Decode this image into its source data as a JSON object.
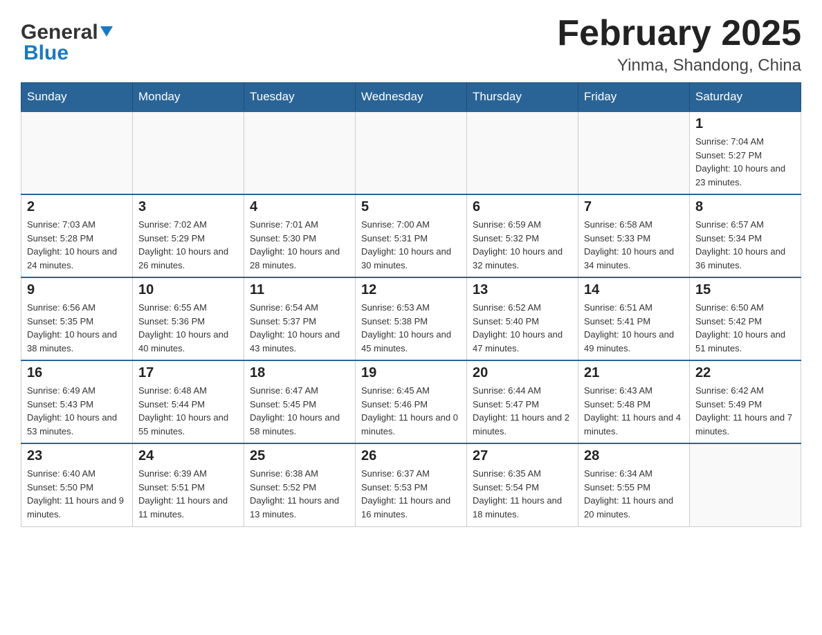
{
  "header": {
    "logo_general": "General",
    "logo_blue": "Blue",
    "month_title": "February 2025",
    "location": "Yinma, Shandong, China"
  },
  "weekdays": [
    "Sunday",
    "Monday",
    "Tuesday",
    "Wednesday",
    "Thursday",
    "Friday",
    "Saturday"
  ],
  "weeks": [
    [
      {
        "day": "",
        "sunrise": "",
        "sunset": "",
        "daylight": ""
      },
      {
        "day": "",
        "sunrise": "",
        "sunset": "",
        "daylight": ""
      },
      {
        "day": "",
        "sunrise": "",
        "sunset": "",
        "daylight": ""
      },
      {
        "day": "",
        "sunrise": "",
        "sunset": "",
        "daylight": ""
      },
      {
        "day": "",
        "sunrise": "",
        "sunset": "",
        "daylight": ""
      },
      {
        "day": "",
        "sunrise": "",
        "sunset": "",
        "daylight": ""
      },
      {
        "day": "1",
        "sunrise": "Sunrise: 7:04 AM",
        "sunset": "Sunset: 5:27 PM",
        "daylight": "Daylight: 10 hours and 23 minutes."
      }
    ],
    [
      {
        "day": "2",
        "sunrise": "Sunrise: 7:03 AM",
        "sunset": "Sunset: 5:28 PM",
        "daylight": "Daylight: 10 hours and 24 minutes."
      },
      {
        "day": "3",
        "sunrise": "Sunrise: 7:02 AM",
        "sunset": "Sunset: 5:29 PM",
        "daylight": "Daylight: 10 hours and 26 minutes."
      },
      {
        "day": "4",
        "sunrise": "Sunrise: 7:01 AM",
        "sunset": "Sunset: 5:30 PM",
        "daylight": "Daylight: 10 hours and 28 minutes."
      },
      {
        "day": "5",
        "sunrise": "Sunrise: 7:00 AM",
        "sunset": "Sunset: 5:31 PM",
        "daylight": "Daylight: 10 hours and 30 minutes."
      },
      {
        "day": "6",
        "sunrise": "Sunrise: 6:59 AM",
        "sunset": "Sunset: 5:32 PM",
        "daylight": "Daylight: 10 hours and 32 minutes."
      },
      {
        "day": "7",
        "sunrise": "Sunrise: 6:58 AM",
        "sunset": "Sunset: 5:33 PM",
        "daylight": "Daylight: 10 hours and 34 minutes."
      },
      {
        "day": "8",
        "sunrise": "Sunrise: 6:57 AM",
        "sunset": "Sunset: 5:34 PM",
        "daylight": "Daylight: 10 hours and 36 minutes."
      }
    ],
    [
      {
        "day": "9",
        "sunrise": "Sunrise: 6:56 AM",
        "sunset": "Sunset: 5:35 PM",
        "daylight": "Daylight: 10 hours and 38 minutes."
      },
      {
        "day": "10",
        "sunrise": "Sunrise: 6:55 AM",
        "sunset": "Sunset: 5:36 PM",
        "daylight": "Daylight: 10 hours and 40 minutes."
      },
      {
        "day": "11",
        "sunrise": "Sunrise: 6:54 AM",
        "sunset": "Sunset: 5:37 PM",
        "daylight": "Daylight: 10 hours and 43 minutes."
      },
      {
        "day": "12",
        "sunrise": "Sunrise: 6:53 AM",
        "sunset": "Sunset: 5:38 PM",
        "daylight": "Daylight: 10 hours and 45 minutes."
      },
      {
        "day": "13",
        "sunrise": "Sunrise: 6:52 AM",
        "sunset": "Sunset: 5:40 PM",
        "daylight": "Daylight: 10 hours and 47 minutes."
      },
      {
        "day": "14",
        "sunrise": "Sunrise: 6:51 AM",
        "sunset": "Sunset: 5:41 PM",
        "daylight": "Daylight: 10 hours and 49 minutes."
      },
      {
        "day": "15",
        "sunrise": "Sunrise: 6:50 AM",
        "sunset": "Sunset: 5:42 PM",
        "daylight": "Daylight: 10 hours and 51 minutes."
      }
    ],
    [
      {
        "day": "16",
        "sunrise": "Sunrise: 6:49 AM",
        "sunset": "Sunset: 5:43 PM",
        "daylight": "Daylight: 10 hours and 53 minutes."
      },
      {
        "day": "17",
        "sunrise": "Sunrise: 6:48 AM",
        "sunset": "Sunset: 5:44 PM",
        "daylight": "Daylight: 10 hours and 55 minutes."
      },
      {
        "day": "18",
        "sunrise": "Sunrise: 6:47 AM",
        "sunset": "Sunset: 5:45 PM",
        "daylight": "Daylight: 10 hours and 58 minutes."
      },
      {
        "day": "19",
        "sunrise": "Sunrise: 6:45 AM",
        "sunset": "Sunset: 5:46 PM",
        "daylight": "Daylight: 11 hours and 0 minutes."
      },
      {
        "day": "20",
        "sunrise": "Sunrise: 6:44 AM",
        "sunset": "Sunset: 5:47 PM",
        "daylight": "Daylight: 11 hours and 2 minutes."
      },
      {
        "day": "21",
        "sunrise": "Sunrise: 6:43 AM",
        "sunset": "Sunset: 5:48 PM",
        "daylight": "Daylight: 11 hours and 4 minutes."
      },
      {
        "day": "22",
        "sunrise": "Sunrise: 6:42 AM",
        "sunset": "Sunset: 5:49 PM",
        "daylight": "Daylight: 11 hours and 7 minutes."
      }
    ],
    [
      {
        "day": "23",
        "sunrise": "Sunrise: 6:40 AM",
        "sunset": "Sunset: 5:50 PM",
        "daylight": "Daylight: 11 hours and 9 minutes."
      },
      {
        "day": "24",
        "sunrise": "Sunrise: 6:39 AM",
        "sunset": "Sunset: 5:51 PM",
        "daylight": "Daylight: 11 hours and 11 minutes."
      },
      {
        "day": "25",
        "sunrise": "Sunrise: 6:38 AM",
        "sunset": "Sunset: 5:52 PM",
        "daylight": "Daylight: 11 hours and 13 minutes."
      },
      {
        "day": "26",
        "sunrise": "Sunrise: 6:37 AM",
        "sunset": "Sunset: 5:53 PM",
        "daylight": "Daylight: 11 hours and 16 minutes."
      },
      {
        "day": "27",
        "sunrise": "Sunrise: 6:35 AM",
        "sunset": "Sunset: 5:54 PM",
        "daylight": "Daylight: 11 hours and 18 minutes."
      },
      {
        "day": "28",
        "sunrise": "Sunrise: 6:34 AM",
        "sunset": "Sunset: 5:55 PM",
        "daylight": "Daylight: 11 hours and 20 minutes."
      },
      {
        "day": "",
        "sunrise": "",
        "sunset": "",
        "daylight": ""
      }
    ]
  ]
}
